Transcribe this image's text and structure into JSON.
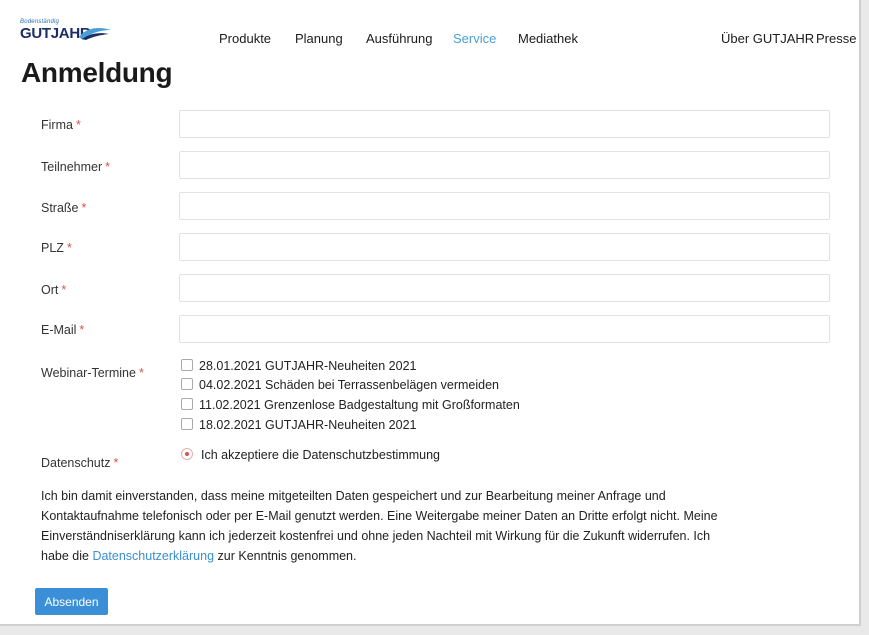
{
  "header": {
    "logo_tagline": "Bodenständig",
    "logo_text": "GUTJAHR",
    "nav": [
      "Produkte",
      "Planung",
      "Ausführung",
      "Service",
      "Mediathek"
    ],
    "active_nav": "Service",
    "nav_right": [
      "Über GUTJAHR",
      "Presse"
    ]
  },
  "page": {
    "title": "Anmeldung"
  },
  "form": {
    "required_mark": "*",
    "fields": [
      {
        "label": "Firma",
        "value": ""
      },
      {
        "label": "Teilnehmer",
        "value": ""
      },
      {
        "label": "Straße",
        "value": ""
      },
      {
        "label": "PLZ",
        "value": ""
      },
      {
        "label": "Ort",
        "value": ""
      },
      {
        "label": "E-Mail",
        "value": ""
      }
    ],
    "webinar_label": "Webinar-Termine",
    "webinar_options": [
      {
        "label": "28.01.2021 GUTJAHR-Neuheiten 2021",
        "checked": false
      },
      {
        "label": "04.02.2021 Schäden bei Terrassenbelägen vermeiden",
        "checked": false
      },
      {
        "label": "11.02.2021 Grenzenlose Badgestaltung mit Großformaten",
        "checked": false
      },
      {
        "label": "18.02.2021 GUTJAHR-Neuheiten 2021",
        "checked": false
      }
    ],
    "privacy_label": "Datenschutz",
    "privacy_option": "Ich akzeptiere die Datenschutzbestimmung",
    "consent_text_1": "Ich bin damit einverstanden, dass meine mitgeteilten Daten gespeichert und zur Bearbeitung meiner Anfrage und Kontaktaufnahme telefonisch oder per E-Mail genutzt werden. Eine Weitergabe meiner Daten an Dritte erfolgt nicht. Meine Einverständniserklärung kann ich jederzeit kostenfrei und ohne jeden Nachteil mit Wirkung für die Zukunft widerrufen. Ich habe die ",
    "consent_link": "Datenschutzerklärung",
    "consent_text_2": " zur Kenntnis genommen.",
    "submit_label": "Absenden"
  },
  "colors": {
    "accent": "#3a8fd6",
    "active_nav": "#4a9fd8",
    "required": "#d9534f",
    "logo": "#1b2f66"
  }
}
